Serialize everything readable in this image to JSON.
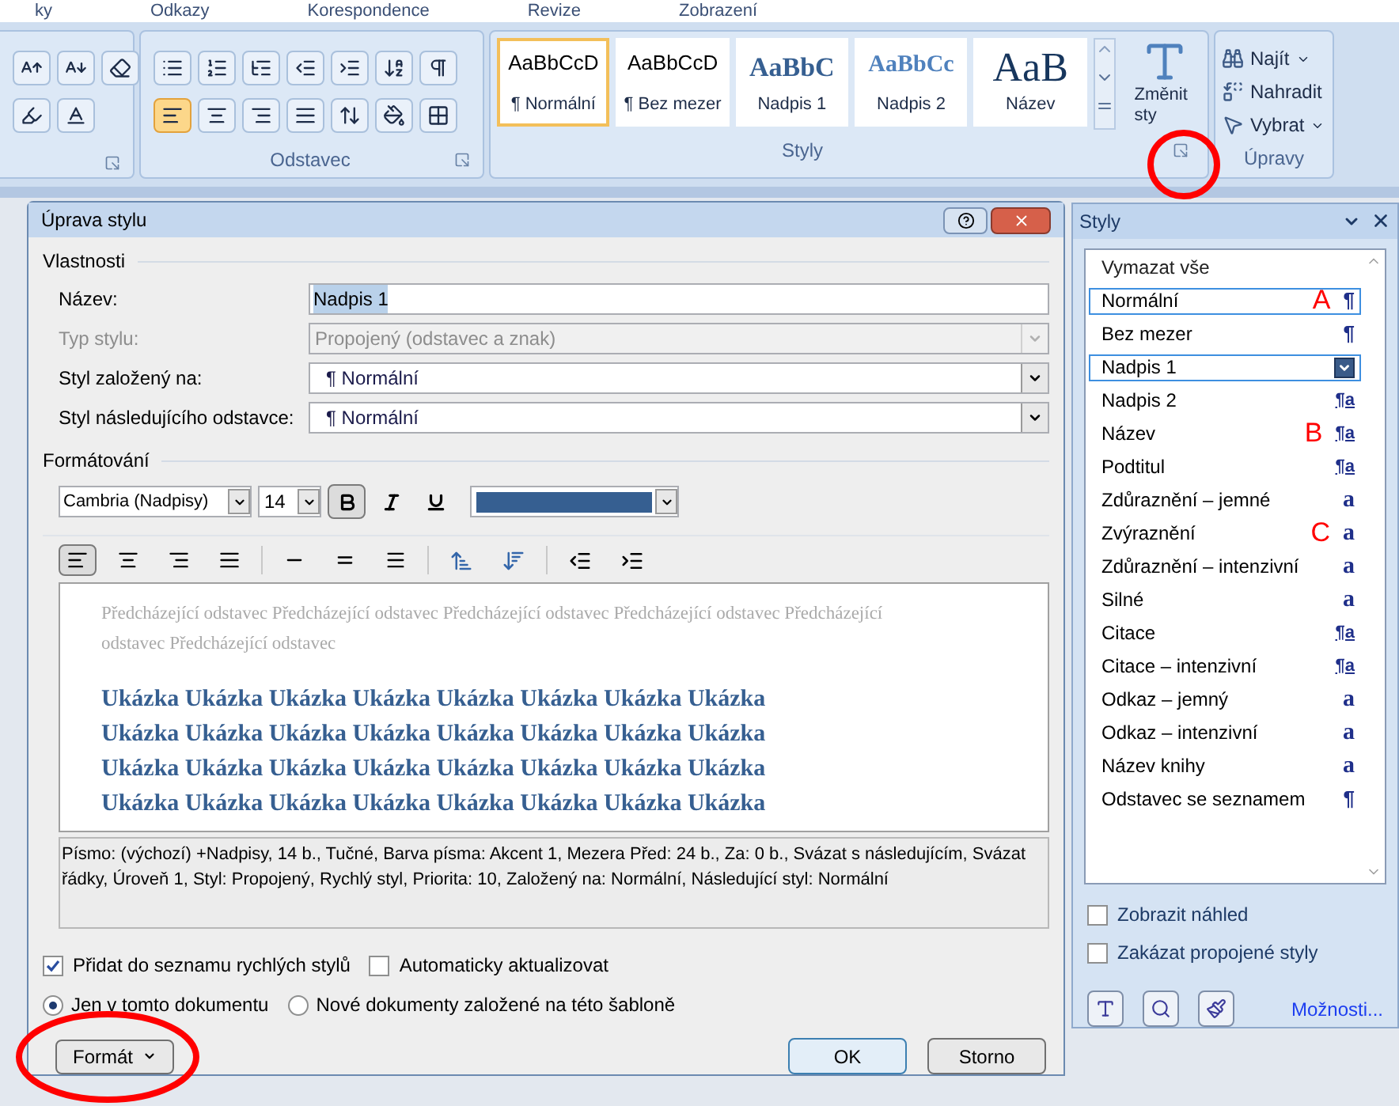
{
  "ribbon": {
    "tabs": [
      "ky",
      "Odkazy",
      "Korespondence",
      "Revize",
      "Zobrazení"
    ],
    "paragraph_group": {
      "label": "Odstavec",
      "align": [
        {
          "kind": "left",
          "selected": true
        },
        {
          "kind": "center",
          "selected": false
        },
        {
          "kind": "right",
          "selected": false
        },
        {
          "kind": "justify",
          "selected": false
        }
      ]
    },
    "styles_group": {
      "label": "Styly",
      "gallery": [
        {
          "preview": "AaBbCcD",
          "name": "¶ Normální",
          "kind": "normal",
          "selected": true
        },
        {
          "preview": "AaBbCcD",
          "name": "¶ Bez mezer",
          "kind": "normal",
          "selected": false
        },
        {
          "preview": "AaBbC",
          "name": "Nadpis 1",
          "kind": "heading1",
          "selected": false
        },
        {
          "preview": "AaBbCc",
          "name": "Nadpis 2",
          "kind": "heading2",
          "selected": false
        },
        {
          "preview": "AaB",
          "name": "Název",
          "kind": "title",
          "selected": false
        }
      ],
      "change_styles": [
        "Změnit",
        "sty"
      ]
    },
    "editing_group": {
      "label": "Úpravy",
      "items": [
        {
          "label": "Najít",
          "kind": "find",
          "dropdown": true
        },
        {
          "label": "Nahradit",
          "kind": "replace",
          "dropdown": false
        },
        {
          "label": "Vybrat",
          "kind": "select",
          "dropdown": true
        }
      ]
    }
  },
  "dialog": {
    "title": "Úprava stylu",
    "properties_label": "Vlastnosti",
    "fields": [
      {
        "label": "Název:",
        "value": "Nadpis 1",
        "kind": "text",
        "disabled": false
      },
      {
        "label": "Typ stylu:",
        "value": "Propojený (odstavec a znak)",
        "kind": "select",
        "disabled": true
      },
      {
        "label": "Styl založený na:",
        "value": "¶ Normální",
        "kind": "select",
        "disabled": false
      },
      {
        "label": "Styl následujícího odstavce:",
        "value": "¶ Normální",
        "kind": "select",
        "disabled": false
      }
    ],
    "formatting_label": "Formátování",
    "font": "Cambria (Nadpisy)",
    "size": "14",
    "bold": true,
    "italic": false,
    "underline": false,
    "color": "#365f91",
    "alignment": [
      {
        "kind": "left",
        "selected": true
      },
      {
        "kind": "center",
        "selected": false
      },
      {
        "kind": "right",
        "selected": false
      },
      {
        "kind": "justify",
        "selected": false
      }
    ],
    "preview_previous": "Předcházející odstavec Předcházející odstavec Předcházející odstavec Předcházející odstavec Předcházející odstavec Předcházející odstavec",
    "preview_sample": "Ukázka Ukázka Ukázka Ukázka Ukázka Ukázka Ukázka Ukázka Ukázka Ukázka Ukázka Ukázka Ukázka Ukázka Ukázka Ukázka Ukázka Ukázka Ukázka Ukázka Ukázka Ukázka Ukázka Ukázka Ukázka Ukázka Ukázka Ukázka Ukázka Ukázka Ukázka Ukázka",
    "description": "Písmo: (výchozí) +Nadpisy, 14 b., Tučné, Barva písma: Akcent 1, Mezera Před:  24 b., Za:  0 b., Svázat s následujícím, Svázat řádky, Úroveň 1, Styl: Propojený, Rychlý styl, Priorita:  10, Založený na: Normální, Následující styl: Normální",
    "checkboxes": [
      {
        "label": "Přidat do seznamu rychlých stylů",
        "checked": true
      },
      {
        "label": "Automaticky aktualizovat",
        "checked": false
      }
    ],
    "radios": [
      {
        "label": "Jen v tomto dokumentu",
        "selected": true
      },
      {
        "label": "Nové dokumenty založené na této šabloně",
        "selected": false
      }
    ],
    "format_button": "Formát",
    "ok_button": "OK",
    "cancel_button": "Storno"
  },
  "styles_pane": {
    "title": "Styly",
    "items": [
      {
        "name": "Vymazat vše",
        "kind": "clear",
        "selected": false,
        "hovered": false
      },
      {
        "name": "Normální",
        "kind": "paragraph",
        "symbol": "¶",
        "marker": "A",
        "selected": true,
        "hovered": false
      },
      {
        "name": "Bez mezer",
        "kind": "paragraph",
        "symbol": "¶",
        "selected": false,
        "hovered": false
      },
      {
        "name": "Nadpis 1",
        "kind": "linked",
        "selected": true,
        "hovered": true
      },
      {
        "name": "Nadpis 2",
        "kind": "linked",
        "symbol": "¶a",
        "selected": false,
        "hovered": false
      },
      {
        "name": "Název",
        "kind": "linked",
        "symbol": "¶a",
        "marker": "B",
        "selected": false,
        "hovered": false
      },
      {
        "name": "Podtitul",
        "kind": "linked",
        "symbol": "¶a",
        "selected": false,
        "hovered": false
      },
      {
        "name": "Zdůraznění – jemné",
        "kind": "character",
        "symbol": "a",
        "selected": false,
        "hovered": false
      },
      {
        "name": "Zvýraznění",
        "kind": "character",
        "symbol": "a",
        "marker": "C",
        "selected": false,
        "hovered": false
      },
      {
        "name": "Zdůraznění – intenzivní",
        "kind": "character",
        "symbol": "a",
        "selected": false,
        "hovered": false
      },
      {
        "name": "Silné",
        "kind": "character",
        "symbol": "a",
        "selected": false,
        "hovered": false
      },
      {
        "name": "Citace",
        "kind": "linked",
        "symbol": "¶a",
        "selected": false,
        "hovered": false
      },
      {
        "name": "Citace – intenzivní",
        "kind": "linked",
        "symbol": "¶a",
        "selected": false,
        "hovered": false
      },
      {
        "name": "Odkaz – jemný",
        "kind": "character",
        "symbol": "a",
        "selected": false,
        "hovered": false
      },
      {
        "name": "Odkaz – intenzivní",
        "kind": "character",
        "symbol": "a",
        "selected": false,
        "hovered": false
      },
      {
        "name": "Název knihy",
        "kind": "character",
        "symbol": "a",
        "selected": false,
        "hovered": false
      },
      {
        "name": "Odstavec se seznamem",
        "kind": "paragraph",
        "symbol": "¶",
        "selected": false,
        "hovered": false
      }
    ],
    "checkboxes": [
      {
        "label": "Zobrazit náhled",
        "checked": false
      },
      {
        "label": "Zakázat propojené styly",
        "checked": false
      }
    ],
    "options_link": "Možnosti..."
  }
}
